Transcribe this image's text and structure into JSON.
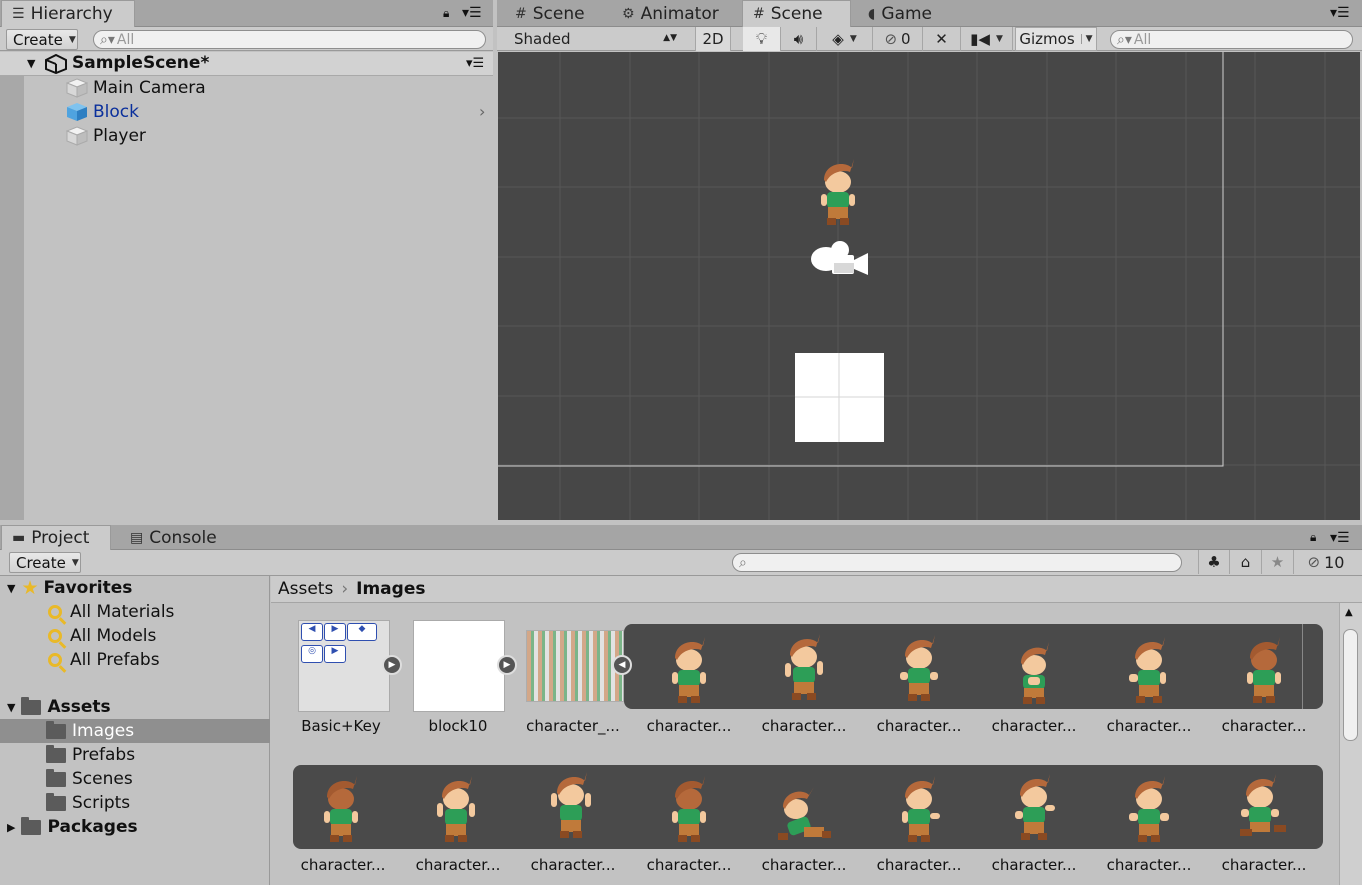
{
  "hierarchy": {
    "tab_label": "Hierarchy",
    "create_label": "Create",
    "search_placeholder": "All",
    "scene_name": "SampleScene*",
    "items": [
      {
        "label": "Main Camera",
        "selected": false
      },
      {
        "label": "Block",
        "selected": true
      },
      {
        "label": "Player",
        "selected": false
      }
    ]
  },
  "center_tabs": [
    {
      "label": "Scene",
      "icon": "grid-icon"
    },
    {
      "label": "Animator",
      "icon": "animator-icon"
    },
    {
      "label": "Scene",
      "icon": "grid-icon",
      "active": true
    },
    {
      "label": "Game",
      "icon": "pacman-icon"
    }
  ],
  "scene_toolbar": {
    "shading_mode": "Shaded",
    "mode_2d": "2D",
    "hidden_count": "0",
    "gizmos_label": "Gizmos",
    "search_placeholder": "All"
  },
  "bottom_tabs": [
    {
      "label": "Project",
      "icon": "folder-icon",
      "active": true
    },
    {
      "label": "Console",
      "icon": "console-icon"
    }
  ],
  "project": {
    "create_label": "Create",
    "hidden_count": "10",
    "breadcrumb": [
      "Assets",
      "Images"
    ],
    "tree": {
      "favorites_label": "Favorites",
      "favorites": [
        "All Materials",
        "All Models",
        "All Prefabs"
      ],
      "assets_label": "Assets",
      "assets_children": [
        "Images",
        "Prefabs",
        "Scenes",
        "Scripts"
      ],
      "packages_label": "Packages"
    },
    "grid_row1": [
      "Basic+Key",
      "block10",
      "character_...",
      "character...",
      "character...",
      "character...",
      "character...",
      "character...",
      "character..."
    ],
    "grid_row2": [
      "character...",
      "character...",
      "character...",
      "character...",
      "character...",
      "character...",
      "character...",
      "character...",
      "character..."
    ]
  },
  "colors": {
    "scene_bg": "#474747",
    "grid_line": "#5a5a5a",
    "selected_text": "#0a2f9c",
    "character_hair": "#b5693b",
    "character_shirt": "#2d9e57",
    "character_pants": "#c07a3a",
    "sprite_strip_bg": "#4a4a4a"
  }
}
